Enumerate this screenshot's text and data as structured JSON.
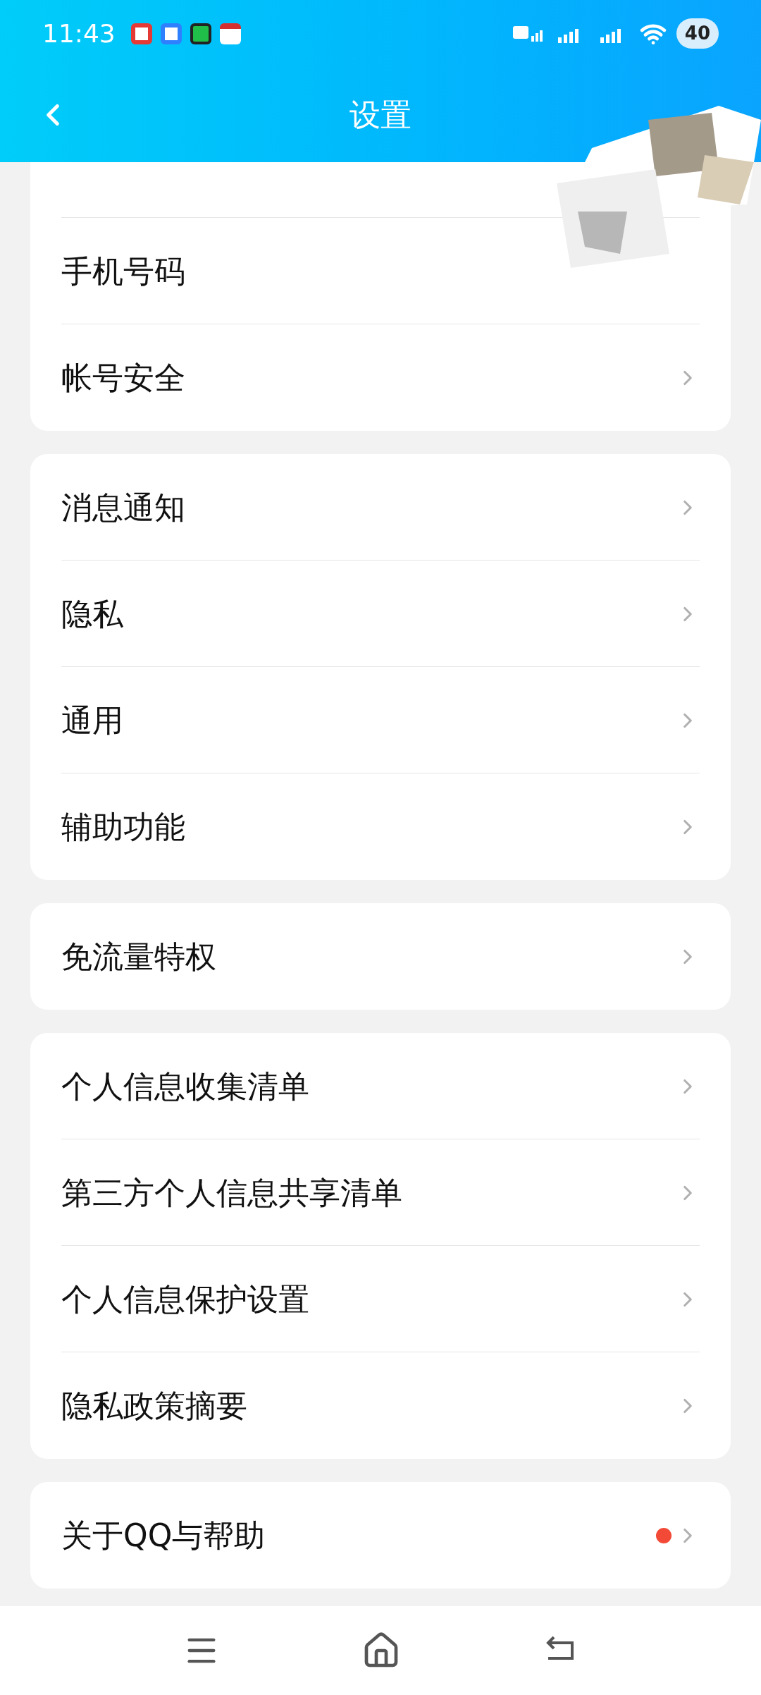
{
  "status_bar": {
    "time": "11:43",
    "battery": "40"
  },
  "header": {
    "title": "设置"
  },
  "groups": [
    {
      "rows": [
        {
          "label": "手机号码",
          "chevron": false,
          "dot": false
        },
        {
          "label": "帐号安全",
          "chevron": true,
          "dot": false
        }
      ]
    },
    {
      "rows": [
        {
          "label": "消息通知",
          "chevron": true,
          "dot": false
        },
        {
          "label": "隐私",
          "chevron": true,
          "dot": false
        },
        {
          "label": "通用",
          "chevron": true,
          "dot": false
        },
        {
          "label": "辅助功能",
          "chevron": true,
          "dot": false
        }
      ]
    },
    {
      "rows": [
        {
          "label": "免流量特权",
          "chevron": true,
          "dot": false
        }
      ]
    },
    {
      "rows": [
        {
          "label": "个人信息收集清单",
          "chevron": true,
          "dot": false
        },
        {
          "label": "第三方个人信息共享清单",
          "chevron": true,
          "dot": false
        },
        {
          "label": "个人信息保护设置",
          "chevron": true,
          "dot": false
        },
        {
          "label": "隐私政策摘要",
          "chevron": true,
          "dot": false
        }
      ]
    },
    {
      "rows": [
        {
          "label": "关于QQ与帮助",
          "chevron": true,
          "dot": true
        }
      ]
    }
  ]
}
